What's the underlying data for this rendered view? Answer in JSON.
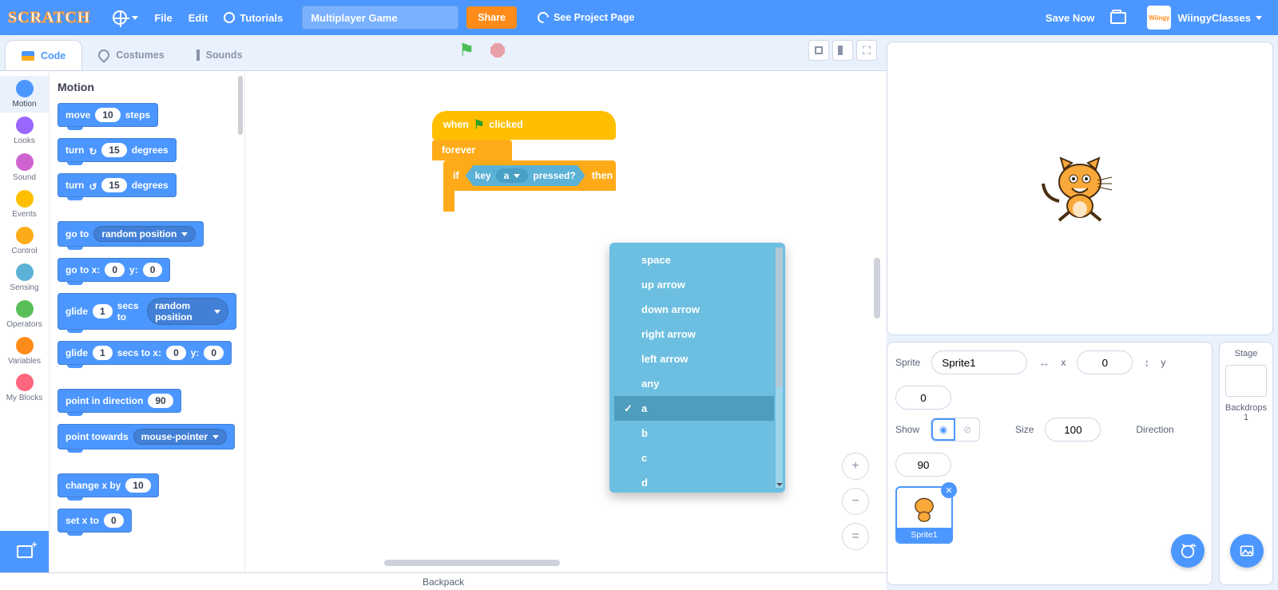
{
  "topbar": {
    "menu": {
      "file": "File",
      "edit": "Edit",
      "tutorials": "Tutorials"
    },
    "project_title": "Multiplayer Game",
    "share": "Share",
    "see_project": "See Project Page",
    "save_now": "Save Now",
    "username": "WiingyClasses",
    "avatar_text": "Wiingy"
  },
  "tabs": {
    "code": "Code",
    "costumes": "Costumes",
    "sounds": "Sounds"
  },
  "categories": [
    {
      "name": "Motion",
      "color": "#4c97ff",
      "active": true
    },
    {
      "name": "Looks",
      "color": "#9966ff"
    },
    {
      "name": "Sound",
      "color": "#cf63cf"
    },
    {
      "name": "Events",
      "color": "#ffbf00"
    },
    {
      "name": "Control",
      "color": "#ffab19"
    },
    {
      "name": "Sensing",
      "color": "#5cb1d6"
    },
    {
      "name": "Operators",
      "color": "#59c059"
    },
    {
      "name": "Variables",
      "color": "#ff8c1a"
    },
    {
      "name": "My Blocks",
      "color": "#ff6680"
    }
  ],
  "palette": {
    "heading": "Motion",
    "blocks": {
      "move": {
        "pre": "move",
        "val": "10",
        "post": "steps"
      },
      "turn_cw": {
        "pre": "turn",
        "icon": "↻",
        "val": "15",
        "post": "degrees"
      },
      "turn_ccw": {
        "pre": "turn",
        "icon": "↺",
        "val": "15",
        "post": "degrees"
      },
      "goto": {
        "pre": "go to",
        "opt": "random position"
      },
      "gotoxy": {
        "pre": "go to x:",
        "x": "0",
        "mid": "y:",
        "y": "0"
      },
      "glide": {
        "pre": "glide",
        "secs": "1",
        "mid": "secs to",
        "opt": "random position"
      },
      "glidexy": {
        "pre": "glide",
        "secs": "1",
        "mid": "secs to x:",
        "x": "0",
        "mid2": "y:",
        "y": "0"
      },
      "pointdir": {
        "pre": "point in direction",
        "val": "90"
      },
      "pointto": {
        "pre": "point towards",
        "opt": "mouse-pointer"
      },
      "changex": {
        "pre": "change x by",
        "val": "10"
      },
      "setx": {
        "pre": "set x to",
        "val": "0"
      }
    }
  },
  "script": {
    "hat": {
      "pre": "when",
      "post": "clicked"
    },
    "forever": "forever",
    "ifrow": {
      "if": "if",
      "then": "then"
    },
    "sensing": {
      "key": "key",
      "opt": "a",
      "pressed": "pressed?"
    }
  },
  "dropdown": {
    "options": [
      "space",
      "up arrow",
      "down arrow",
      "right arrow",
      "left arrow",
      "any",
      "a",
      "b",
      "c",
      "d"
    ],
    "selected": "a"
  },
  "sprite_info": {
    "label_sprite": "Sprite",
    "name": "Sprite1",
    "label_x": "x",
    "x": "0",
    "label_y": "y",
    "y": "0",
    "label_show": "Show",
    "label_size": "Size",
    "size": "100",
    "label_dir": "Direction",
    "dir": "90",
    "thumb_name": "Sprite1"
  },
  "stage_panel": {
    "title": "Stage",
    "backdrops_label": "Backdrops",
    "backdrops": "1"
  },
  "zoom": {
    "in": "+",
    "out": "−",
    "eq": "="
  },
  "backpack": "Backpack"
}
